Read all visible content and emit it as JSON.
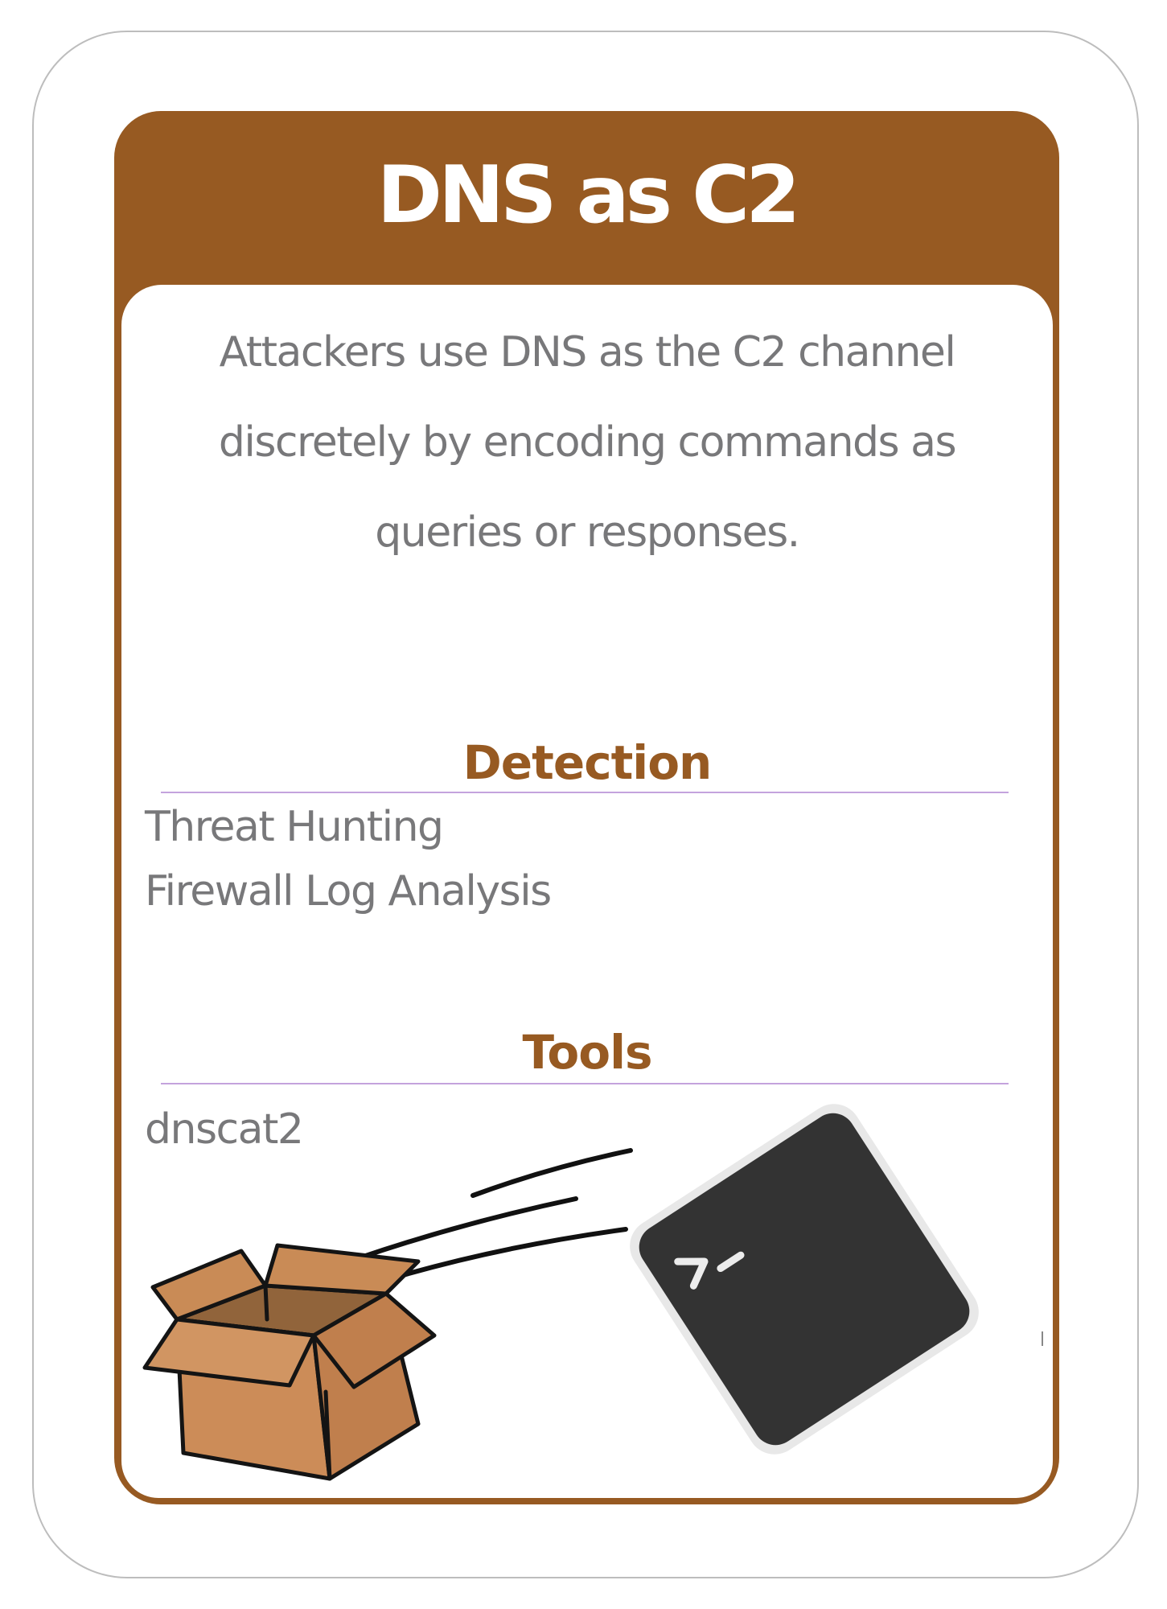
{
  "card": {
    "title": "DNS as C2",
    "description_lines": [
      "Attackers use DNS as the C2 channel",
      "discretely by encoding commands as",
      "queries or responses."
    ],
    "detection": {
      "heading": "Detection",
      "items": [
        "Threat Hunting",
        "Firewall Log Analysis"
      ]
    },
    "tools": {
      "heading": "Tools",
      "items": [
        "dnscat2"
      ]
    }
  },
  "colors": {
    "accent": "#975a22",
    "text": "#78787a",
    "rule": "#c4a3dd",
    "box": "#cc8c58",
    "terminal": "#333333"
  },
  "illustration": {
    "box_icon": "open-cardboard-box-icon",
    "terminal_icon": "terminal-prompt-icon",
    "terminal_prompt": ">_"
  }
}
